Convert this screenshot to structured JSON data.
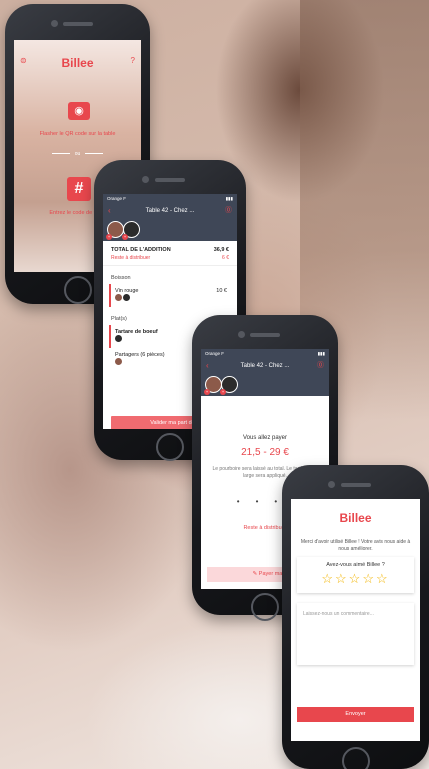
{
  "app": {
    "logo": "Billee"
  },
  "home_screen": {
    "scan_label": "Flasher le QR code sur la table",
    "or_label": "ou",
    "code_label": "Entrez le code de table"
  },
  "bill_screen": {
    "status_carrier": "Orange F",
    "table_title": "Table 42 - Chez ...",
    "total_label": "TOTAL DE L'ADDITION",
    "total_value": "36,9 €",
    "rest_label": "Reste à distribuer",
    "rest_value": "6 €",
    "section_drinks": "Boisson",
    "item_wine": "Vin rouge",
    "item_wine_price": "10 €",
    "section_dishes": "Plat(s)",
    "item_tartare": "Tartare de boeuf",
    "item_tartare_price": "",
    "item_share": "Partagers (6 pièces)",
    "item_share_price": "",
    "pay_button": "Valider ma part de l'addition"
  },
  "pay_screen": {
    "status_carrier": "Orange F",
    "table_title": "Table 42 - Chez ...",
    "pay_label": "Vous allez payer",
    "amount": "21,5 - 29 €",
    "note": "Le pourboire sera laissé au total. Le tarif le plus large sera appliqué.",
    "rest": "Reste à distribuer",
    "pay_button": "Payer ma part"
  },
  "rating_screen": {
    "logo": "Billee",
    "thanks": "Merci d'avoir utilisé Billee ! Votre avis nous aide à nous améliorer.",
    "question": "Avez-vous aimé Billee ?",
    "stars": "☆☆☆☆☆",
    "comment_placeholder": "Laissez-nous un commentaire...",
    "send_button": "Envoyer"
  },
  "colors": {
    "brand": "#e8474d",
    "header": "#3f4757",
    "star": "#f2b400"
  }
}
